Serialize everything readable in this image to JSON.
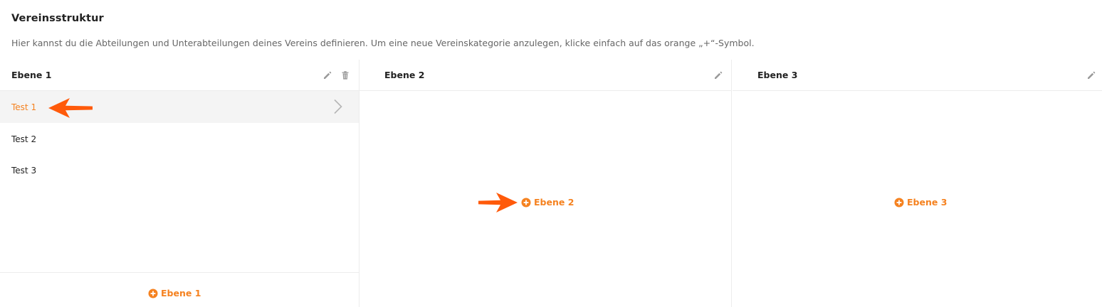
{
  "page": {
    "title": "Vereinsstruktur",
    "description": "Hier kannst du die Abteilungen und Unterabteilungen deines Vereins definieren. Um eine neue Vereinskategorie anzulegen, klicke einfach auf das orange „+“-Symbol."
  },
  "colors": {
    "accent": "#f58220",
    "annotation_arrow": "#ff5a0a",
    "active_row_bg": "#f4f4f4",
    "icon_gray": "#9a9a9a"
  },
  "columns": [
    {
      "title": "Ebene 1",
      "icons": [
        "pencil-icon",
        "trash-icon"
      ],
      "items": [
        {
          "label": "Test 1",
          "active": true
        },
        {
          "label": "Test 2",
          "active": false
        },
        {
          "label": "Test 3",
          "active": false
        }
      ],
      "add_label": "Ebene 1"
    },
    {
      "title": "Ebene 2",
      "icons": [
        "pencil-icon"
      ],
      "items": [],
      "add_label": "Ebene 2"
    },
    {
      "title": "Ebene 3",
      "icons": [
        "pencil-icon"
      ],
      "items": [],
      "add_label": "Ebene 3"
    }
  ]
}
